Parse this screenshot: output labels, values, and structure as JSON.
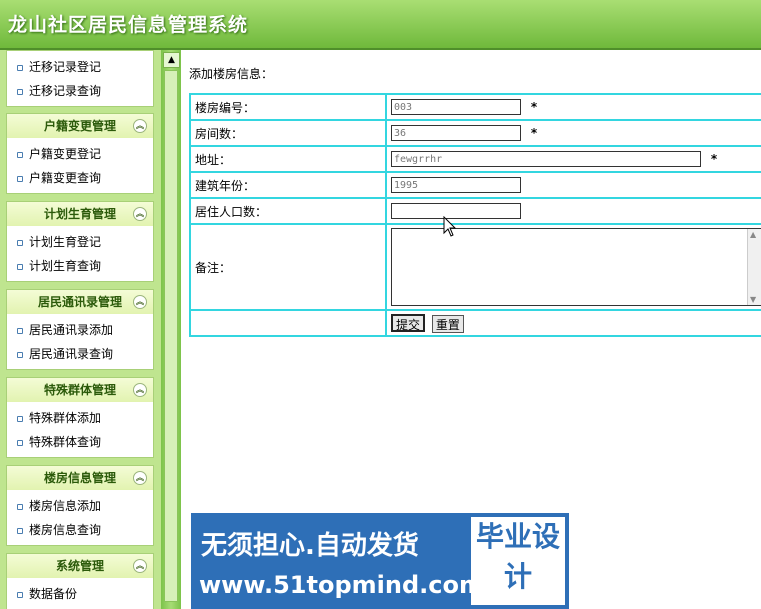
{
  "header": {
    "title": "龙山社区居民信息管理系统"
  },
  "sidebar": {
    "top_items": [
      "迁移记录登记",
      "迁移记录查询"
    ],
    "groups": [
      {
        "title": "户籍变更管理",
        "items": [
          "户籍变更登记",
          "户籍变更查询"
        ]
      },
      {
        "title": "计划生育管理",
        "items": [
          "计划生育登记",
          "计划生育查询"
        ]
      },
      {
        "title": "居民通讯录管理",
        "items": [
          "居民通讯录添加",
          "居民通讯录查询"
        ]
      },
      {
        "title": "特殊群体管理",
        "items": [
          "特殊群体添加",
          "特殊群体查询"
        ]
      },
      {
        "title": "楼房信息管理",
        "items": [
          "楼房信息添加",
          "楼房信息查询"
        ]
      },
      {
        "title": "系统管理",
        "items": [
          "数据备份"
        ]
      }
    ]
  },
  "form": {
    "heading": "添加楼房信息：",
    "fields": [
      {
        "label": "楼房编号：",
        "value": "003",
        "required": "*"
      },
      {
        "label": "房间数：",
        "value": "36",
        "required": "*"
      },
      {
        "label": "地址：",
        "value": "fewgrrhr",
        "required": "*"
      },
      {
        "label": "建筑年份：",
        "value": "1995"
      },
      {
        "label": "居住人口数：",
        "value": ""
      }
    ],
    "remark_label": "备注：",
    "submit_label": "提交",
    "reset_label": "重置"
  },
  "banner": {
    "line1": "无须担心.自动发货",
    "line2": "www.51topmind.com",
    "tag": "毕业设计"
  }
}
